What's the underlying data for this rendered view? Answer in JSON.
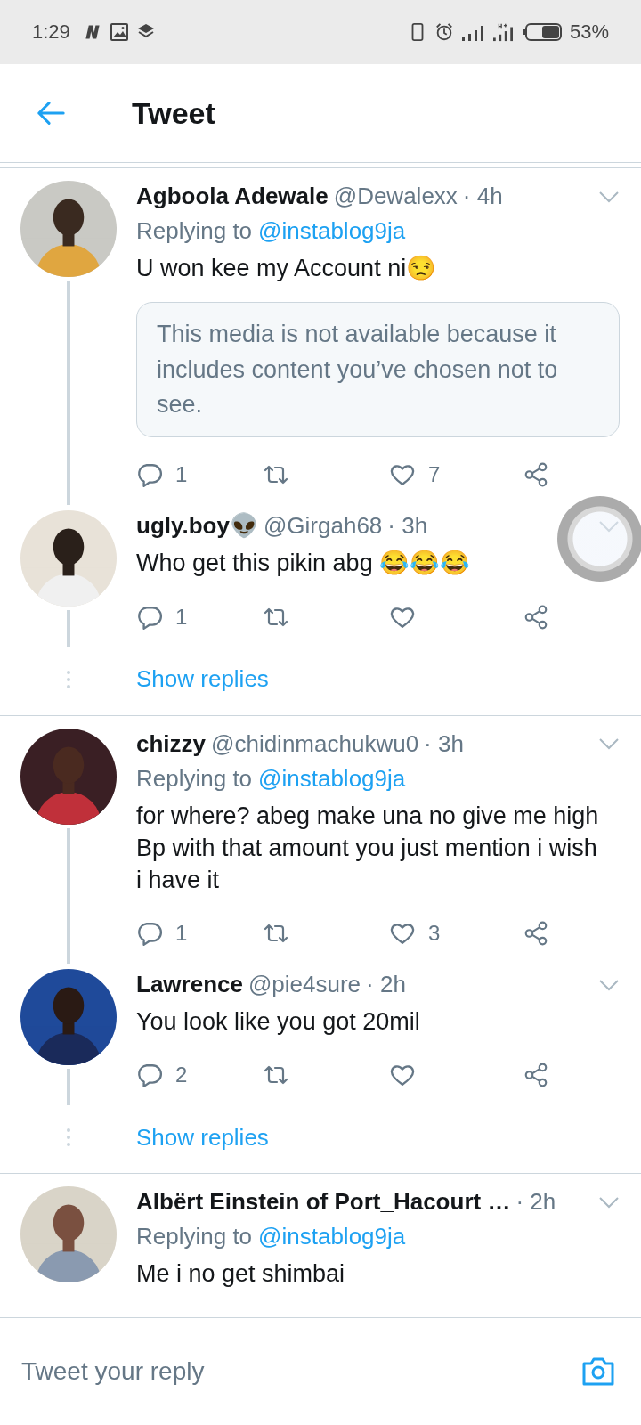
{
  "status_bar": {
    "time": "1:29",
    "battery": "53%"
  },
  "header": {
    "title": "Tweet"
  },
  "threads": [
    {
      "tweets": [
        {
          "name": "Agboola Adewale",
          "handle": "@Dewalexx",
          "time": "· 4h",
          "replying_prefix": "Replying to",
          "replying_to": "@instablog9ja",
          "text": "U won kee my Account ni😒",
          "media_notice": "This media is not available because it includes content you’ve chosen not to see.",
          "reply_count": "1",
          "like_count": "7"
        },
        {
          "name": "ugly.boy👽",
          "handle": "@Girgah68",
          "time": "· 3h",
          "text": "Who get this pikin abg 😂😂😂",
          "reply_count": "1"
        }
      ],
      "show_replies": "Show replies"
    },
    {
      "tweets": [
        {
          "name": "chizzy",
          "handle": "@chidinmachukwu0",
          "time": "· 3h",
          "replying_prefix": "Replying to",
          "replying_to": "@instablog9ja",
          "text": "for where? abeg make una no give me high Bp with that amount you just mention i wish i have it",
          "reply_count": "1",
          "like_count": "3"
        },
        {
          "name": "Lawrence",
          "handle": "@pie4sure",
          "time": "· 2h",
          "text": "You look like you got 20mil",
          "reply_count": "2"
        }
      ],
      "show_replies": "Show replies"
    },
    {
      "tweets": [
        {
          "name": "Albërt Einstein of Port_Hacourt …",
          "time": "· 2h",
          "replying_prefix": "Replying to",
          "replying_to": "@instablog9ja",
          "text": "Me i no get shimbai"
        }
      ]
    }
  ],
  "composer": {
    "placeholder": "Tweet your reply"
  }
}
